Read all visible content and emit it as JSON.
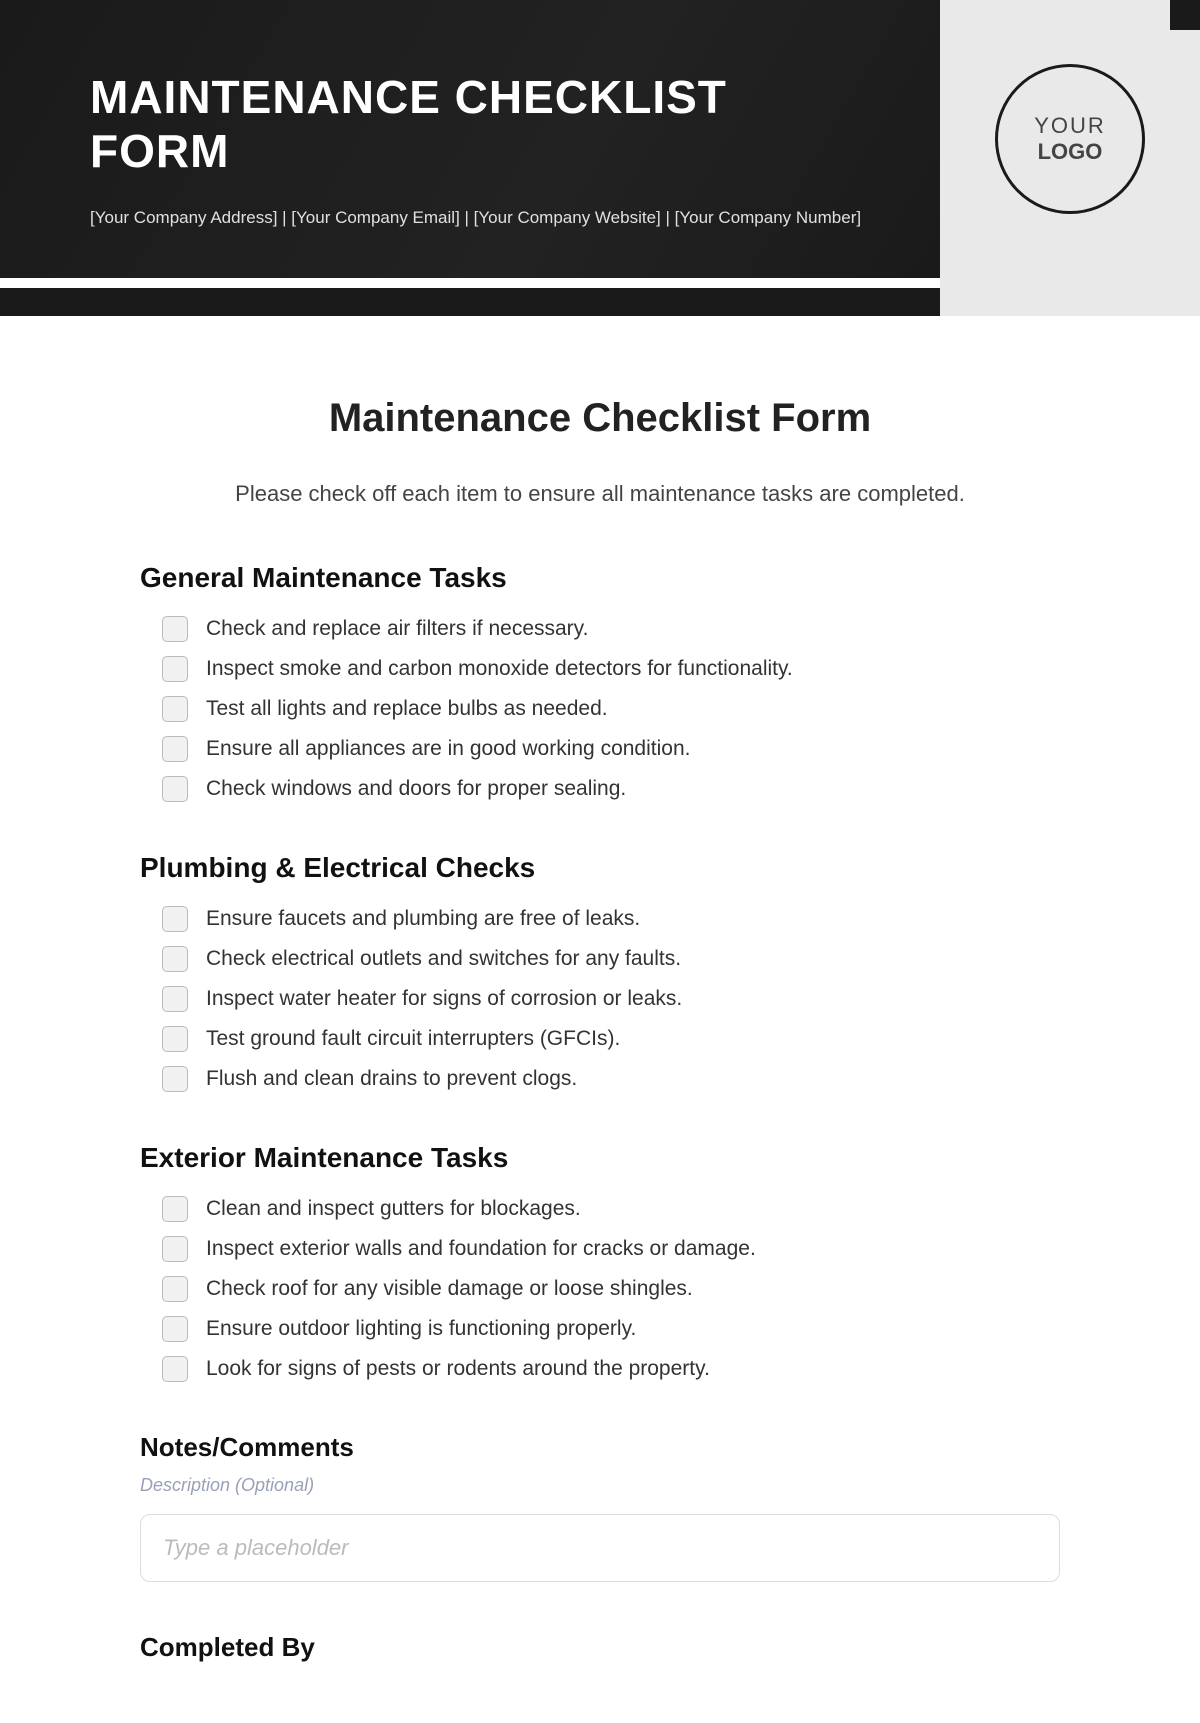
{
  "header": {
    "title": "MAINTENANCE CHECKLIST FORM",
    "subline": "[Your Company Address] | [Your Company Email] | [Your Company Website] | [Your Company Number]",
    "logo_line1": "YOUR",
    "logo_line2": "LOGO"
  },
  "doc": {
    "title": "Maintenance Checklist Form",
    "instructions": "Please check off each item to ensure all maintenance tasks are completed."
  },
  "sections": [
    {
      "title": "General Maintenance Tasks",
      "items": [
        "Check and replace air filters if necessary.",
        "Inspect smoke and carbon monoxide detectors for functionality.",
        "Test all lights and replace bulbs as needed.",
        "Ensure all appliances are in good working condition.",
        "Check windows and doors for proper sealing."
      ]
    },
    {
      "title": "Plumbing & Electrical Checks",
      "items": [
        "Ensure faucets and plumbing are free of leaks.",
        "Check electrical outlets and switches for any faults.",
        "Inspect water heater for signs of corrosion or leaks.",
        "Test ground fault circuit interrupters (GFCIs).",
        "Flush and clean drains to prevent clogs."
      ]
    },
    {
      "title": "Exterior Maintenance Tasks",
      "items": [
        "Clean and inspect gutters for blockages.",
        "Inspect exterior walls and foundation for cracks or damage.",
        "Check roof for any visible damage or loose shingles.",
        "Ensure outdoor lighting is functioning properly.",
        "Look for signs of pests or rodents around the property."
      ]
    }
  ],
  "notes": {
    "label": "Notes/Comments",
    "description": "Description (Optional)",
    "placeholder": "Type a placeholder"
  },
  "completed": {
    "label": "Completed By"
  }
}
